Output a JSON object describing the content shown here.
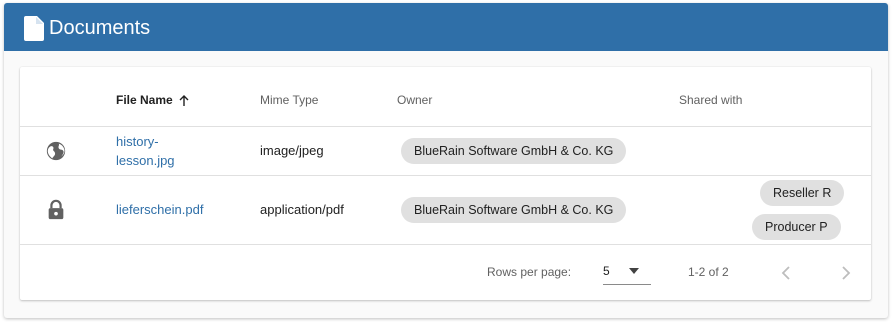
{
  "colors": {
    "header_bg": "#2f6fa8",
    "link": "#2f6fa8",
    "chip_bg": "#e0e0e0"
  },
  "header": {
    "icon": "document-icon",
    "title": "Documents"
  },
  "table": {
    "columns": [
      {
        "key": "file_name",
        "label": "File Name",
        "sorted": "ascending"
      },
      {
        "key": "mime_type",
        "label": "Mime Type"
      },
      {
        "key": "owner",
        "label": "Owner"
      },
      {
        "key": "shared_with",
        "label": "Shared with"
      }
    ],
    "rows": [
      {
        "visibility_icon": "globe-icon",
        "file_name": "history-lesson.jpg",
        "file_name_lines": [
          "history-",
          "lesson.jpg"
        ],
        "mime_type": "image/jpeg",
        "owner": "BlueRain Software GmbH & Co. KG",
        "shared_with": []
      },
      {
        "visibility_icon": "lock-icon",
        "file_name": "lieferschein.pdf",
        "mime_type": "application/pdf",
        "owner": "BlueRain Software GmbH & Co. KG",
        "shared_with": [
          "Reseller R",
          "Producer P"
        ]
      }
    ]
  },
  "footer": {
    "rows_per_page_label": "Rows per page:",
    "rows_per_page_value": "5",
    "range_text": "1-2 of 2",
    "prev_icon": "chevron-left-icon",
    "next_icon": "chevron-right-icon"
  }
}
